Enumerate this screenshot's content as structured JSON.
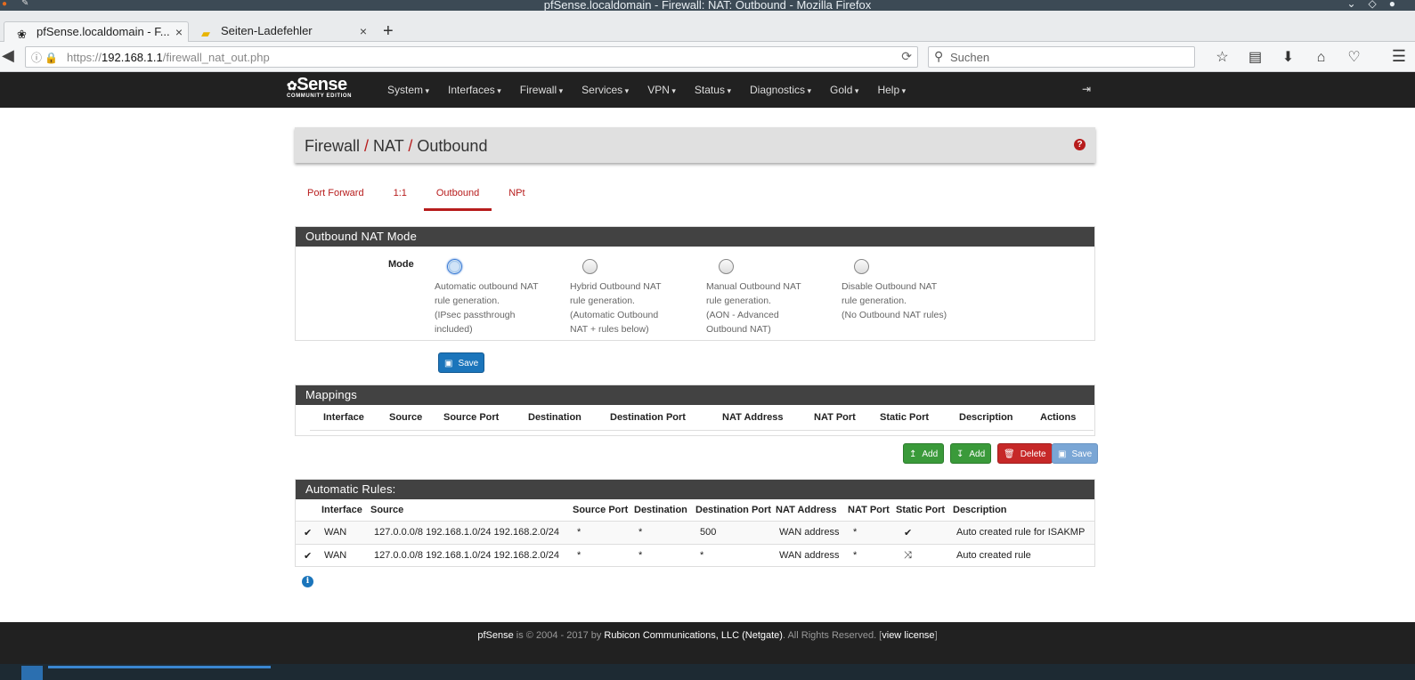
{
  "window": {
    "title": "pfSense.localdomain - Firewall: NAT: Outbound - Mozilla Firefox"
  },
  "tabs": [
    {
      "label": "pfSense.localdomain - F..."
    },
    {
      "label": "Seiten-Ladefehler"
    }
  ],
  "address": {
    "prefix": "https://",
    "host": "192.168.1.1",
    "path": "/firewall_nat_out.php"
  },
  "search": {
    "placeholder": "Suchen"
  },
  "pf": {
    "logo_main": "Sense",
    "logo_sub": "COMMUNITY EDITION",
    "nav": [
      "System",
      "Interfaces",
      "Firewall",
      "Services",
      "VPN",
      "Status",
      "Diagnostics",
      "Gold",
      "Help"
    ]
  },
  "breadcrumb": [
    "Firewall",
    "NAT",
    "Outbound"
  ],
  "page_tabs": [
    "Port Forward",
    "1:1",
    "Outbound",
    "NPt"
  ],
  "mode_panel": {
    "title": "Outbound NAT Mode",
    "label": "Mode",
    "options": [
      {
        "lines": [
          "Automatic outbound NAT",
          "rule generation.",
          "(IPsec passthrough",
          "included)"
        ],
        "selected": true
      },
      {
        "lines": [
          "Hybrid Outbound NAT",
          "rule generation.",
          "(Automatic Outbound",
          "NAT + rules below)"
        ],
        "selected": false
      },
      {
        "lines": [
          "Manual Outbound NAT",
          "rule generation.",
          "(AON - Advanced",
          "Outbound NAT)"
        ],
        "selected": false
      },
      {
        "lines": [
          "Disable Outbound NAT",
          "rule generation.",
          "(No Outbound NAT rules)"
        ],
        "selected": false
      }
    ],
    "save_label": "Save"
  },
  "mappings": {
    "title": "Mappings",
    "columns": [
      "Interface",
      "Source",
      "Source Port",
      "Destination",
      "Destination Port",
      "NAT Address",
      "NAT Port",
      "Static Port",
      "Description",
      "Actions"
    ],
    "buttons": {
      "add_top": "Add",
      "add_bottom": "Add",
      "delete": "Delete",
      "save": "Save"
    }
  },
  "auto_rules": {
    "title": "Automatic Rules:",
    "columns": [
      "Interface",
      "Source",
      "Source Port",
      "Destination",
      "Destination Port",
      "NAT Address",
      "NAT Port",
      "Static Port",
      "Description"
    ],
    "rows": [
      {
        "interface": "WAN",
        "source": "127.0.0.0/8 192.168.1.0/24 192.168.2.0/24",
        "source_port": "*",
        "destination": "*",
        "destination_port": "500",
        "nat_address": "WAN address",
        "nat_port": "*",
        "static_port_icon": "check-icon",
        "description": "Auto created rule for ISAKMP"
      },
      {
        "interface": "WAN",
        "source": "127.0.0.0/8 192.168.1.0/24 192.168.2.0/24",
        "source_port": "*",
        "destination": "*",
        "destination_port": "*",
        "nat_address": "WAN address",
        "nat_port": "*",
        "static_port_icon": "shuffle-icon",
        "description": "Auto created rule"
      }
    ]
  },
  "footer": {
    "brand": "pfSense",
    "text1": " is © 2004 - 2017 by ",
    "company": "Rubicon Communications, LLC (Netgate)",
    "text2": ". All Rights Reserved. [",
    "license": "view license",
    "text3": "]"
  }
}
